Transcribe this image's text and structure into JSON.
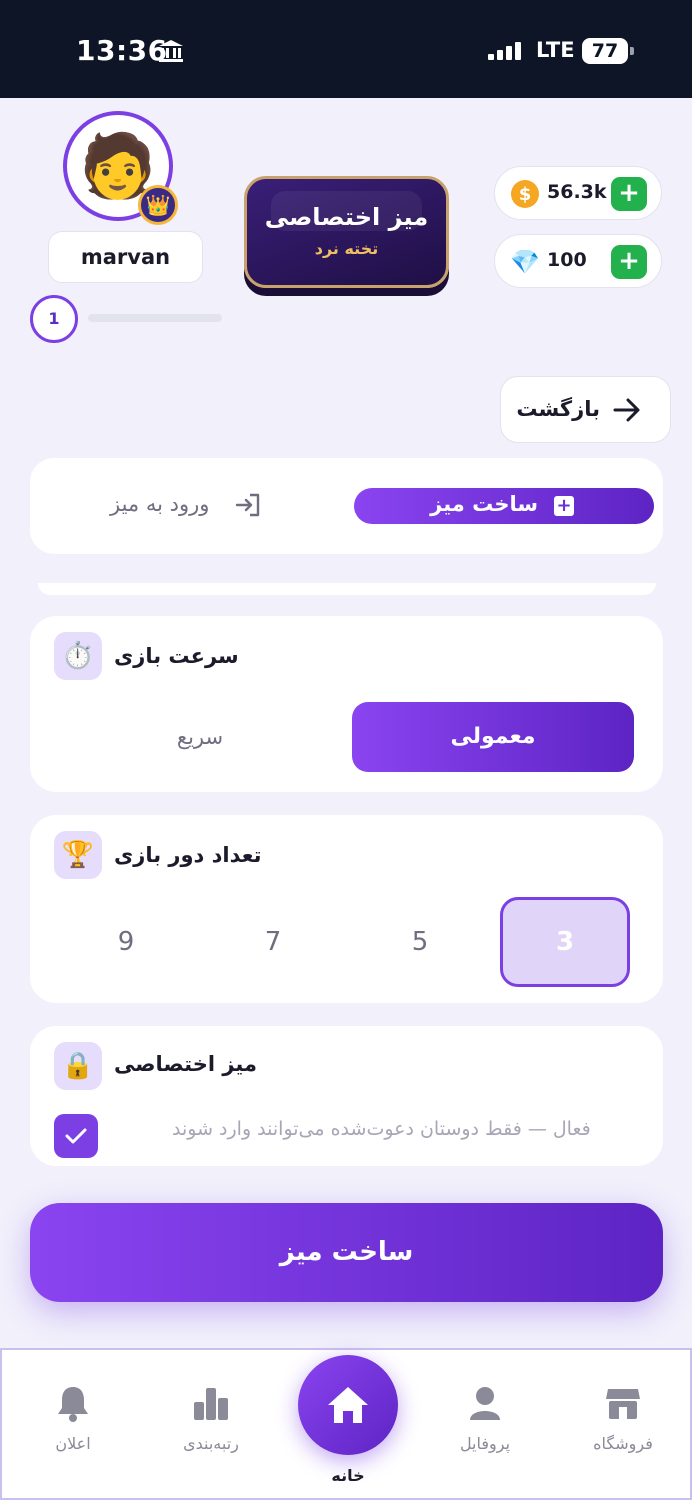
{
  "status_bar": {
    "time": "13:36",
    "network": "LTE",
    "battery": "77"
  },
  "profile": {
    "username": "marvan",
    "level": "1",
    "avatar_emoji": "🧑",
    "crown_emoji": "👑"
  },
  "table_badge": {
    "title": "میز اختصاصی",
    "subtitle": "تخته نرد"
  },
  "currency": {
    "coins": {
      "value": "56.3k",
      "icon": "coin-icon",
      "symbol": "$"
    },
    "gems": {
      "value": "100",
      "icon": "gem-icon",
      "symbol": "💎"
    },
    "add_label": "+"
  },
  "back": {
    "label": "بازگشت"
  },
  "tabs": {
    "create_label": "ساخت میز",
    "join_label": "ورود به میز"
  },
  "speed": {
    "title": "سرعت بازی",
    "icon": "⏱️",
    "options": [
      "معمولی",
      "سریع"
    ],
    "selected": "معمولی"
  },
  "rounds": {
    "title": "تعداد دور بازی",
    "icon": "🏆",
    "options": [
      "3",
      "5",
      "7",
      "9"
    ],
    "selected": "3"
  },
  "private": {
    "title": "میز اختصاصی",
    "icon": "🔒",
    "description": "فعال — فقط دوستان دعوت‌شده می‌توانند وارد شوند",
    "checked": true
  },
  "create_button": {
    "label": "ساخت میز"
  },
  "nav": {
    "shop": "فروشگاه",
    "profile": "پروفایل",
    "home": "خانه",
    "ranking": "رتبه‌بندی",
    "notifications": "اعلان"
  },
  "colors": {
    "accent": "#7b3fe4",
    "accent_dark": "#5d24c4",
    "green": "#22b14c",
    "status_bg": "#0d1526"
  }
}
